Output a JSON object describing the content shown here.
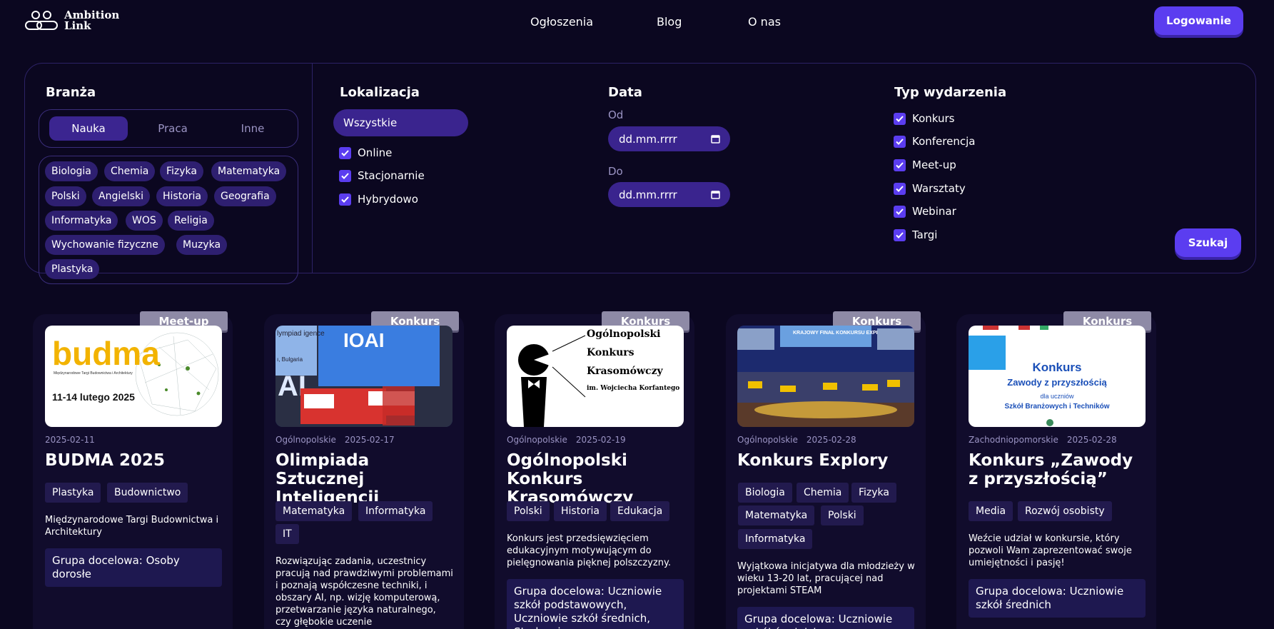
{
  "header": {
    "logo_line1": "Ambition",
    "logo_line2": "Link",
    "nav": [
      "Ogłoszenia",
      "Blog",
      "O nas"
    ],
    "login_label": "Logowanie"
  },
  "filters": {
    "branza": {
      "title": "Branża",
      "segments": [
        "Nauka",
        "Praca",
        "Inne"
      ],
      "active_segment": "Nauka",
      "tags": [
        "Biologia",
        "Chemia",
        "Fizyka",
        "Matematyka",
        "Polski",
        "Angielski",
        "Historia",
        "Geografia",
        "Informatyka",
        "WOS",
        "Religia",
        "Wychowanie fizyczne",
        "Muzyka",
        "Plastyka"
      ]
    },
    "lokalizacja": {
      "title": "Lokalizacja",
      "selected": "Wszystkie",
      "options": [
        "Online",
        "Stacjonarnie",
        "Hybrydowo"
      ]
    },
    "data": {
      "title": "Data",
      "from_label": "Od",
      "from_value": "dd.mm.rrrr",
      "to_label": "Do",
      "to_value": "dd.mm.rrrr"
    },
    "typ": {
      "title": "Typ wydarzenia",
      "options": [
        "Konkurs",
        "Konferencja",
        "Meet-up",
        "Warsztaty",
        "Webinar",
        "Targi"
      ]
    },
    "search_label": "Szukaj"
  },
  "cards": [
    {
      "badge": "Meet-up",
      "image_text": {
        "brand": "budma",
        "subtitle": "Międzynarodowe Targi Budownictwa i Architektury",
        "date": "11-14 lutego 2025"
      },
      "region": "",
      "date": "2025-02-11",
      "title": "BUDMA 2025",
      "tags": [
        "Plastyka",
        "Budownictwo"
      ],
      "description": "Międzynarodowe Targi Budownictwa i Architektury",
      "target": "Grupa docelowa: Osoby dorosłe"
    },
    {
      "badge": "Konkurs",
      "image_text": {
        "left": "lympiad igence",
        "bottom": "ı, Bulgaria",
        "logo": "IOAI",
        "ai": "AI"
      },
      "region": "Ogólnopolskie",
      "date": "2025-02-17",
      "title": "Olimpiada Sztucznej Inteligencji",
      "tags": [
        "Matematyka",
        "Informatyka",
        "IT"
      ],
      "description": "Rozwiązując zadania, uczestnicy pracują nad prawdziwymi problemami i poznają współczesne techniki, i obszary AI, np. wizję komputerową, przetwarzanie języka naturalnego, czy głębokie uczenie",
      "target": ""
    },
    {
      "badge": "Konkurs",
      "image_text": {
        "line1": "Ogólnopolski",
        "line2": "Konkurs",
        "line3": "Krasomówczy",
        "line4": "im. Wojciecha Korfantego"
      },
      "region": "Ogólnopolskie",
      "date": "2025-02-19",
      "title": "Ogólnopolski Konkurs Krasomówczy",
      "tags": [
        "Polski",
        "Historia",
        "Edukacja"
      ],
      "description": "Konkurs jest przedsięwzięciem edukacyjnym motywującym do pielęgnowania pięknej polszczyzny.",
      "target": "Grupa docelowa: Uczniowie szkół podstawowych, Uczniowie szkół średnich, Studenci"
    },
    {
      "badge": "Konkurs",
      "image_text": {
        "banner": "KRAJOWY FINAŁ KONKURSU EXPLORY"
      },
      "region": "Ogólnopolskie",
      "date": "2025-02-28",
      "title": "Konkurs Explory",
      "tags": [
        "Biologia",
        "Chemia",
        "Fizyka",
        "Matematyka",
        "Polski",
        "Informatyka"
      ],
      "description": "Wyjątkowa inicjatywa dla młodzieży w wieku 13-20 lat, pracującej nad projektami STEAM",
      "target": "Grupa docelowa: Uczniowie szkół średnich"
    },
    {
      "badge": "Konkurs",
      "image_text": {
        "line1": "Konkurs",
        "line2": "Zawody z przyszłością",
        "line3": "dla uczniów",
        "line4": "Szkół Branżowych i Techników"
      },
      "region": "Zachodniopomorskie",
      "date": "2025-02-28",
      "title": "Konkurs „Zawody z przyszłością”",
      "tags": [
        "Media",
        "Rozwój osobisty"
      ],
      "description": "Weźcie udział w konkursie, który pozwoli Wam zaprezentować swoje umiejętności i pasję!",
      "target": "Grupa docelowa: Uczniowie szkół średnich"
    }
  ],
  "colors": {
    "background": "#0b0720",
    "accent": "#5b3df0",
    "chip": "#2e1f70",
    "card": "#110c2c",
    "badge": "#8e8aa6"
  }
}
